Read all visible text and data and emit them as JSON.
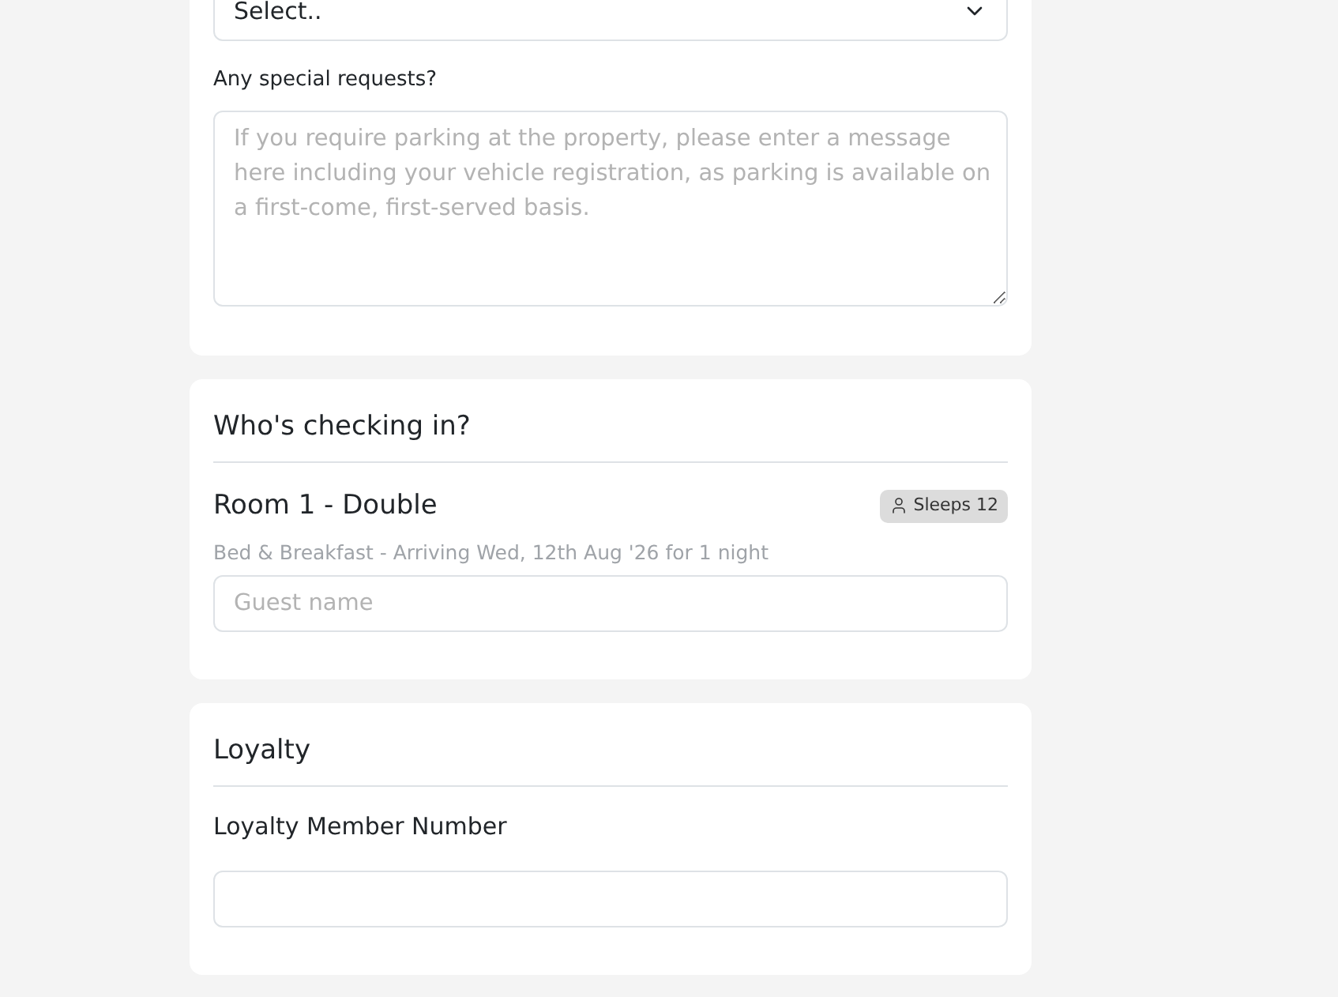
{
  "sections": [
    {
      "fields": [
        {
          "kind": "select",
          "value": "Select.."
        },
        {
          "kind": "textarea",
          "label": "Any special requests?",
          "placeholder": "If you require parking at the property, please enter a message here including your vehicle registration, as parking is available on a first-come, first-served basis."
        }
      ]
    },
    {
      "title": "Who's checking in?",
      "rooms": [
        {
          "name": "Room 1 - Double",
          "badge": "Sleeps 12",
          "details": "Bed & Breakfast - Arriving Wed, 12th Aug '26 for 1 night",
          "guest_field": {
            "placeholder": "Guest name"
          }
        }
      ]
    },
    {
      "title": "Loyalty",
      "fields": [
        {
          "kind": "text",
          "label": "Loyalty Member Number"
        }
      ]
    }
  ]
}
